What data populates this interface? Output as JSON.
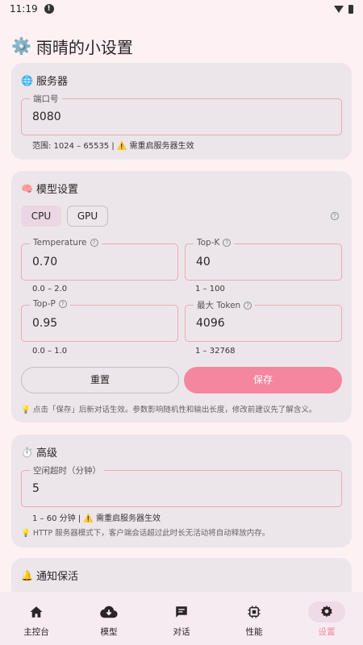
{
  "status_bar": {
    "time": "11:19"
  },
  "header": {
    "title": "雨晴的小设置"
  },
  "server": {
    "title": "服务器",
    "port_label": "端口号",
    "port_value": "8080",
    "hint": "范围: 1024 – 65535 | ⚠️ 需重启服务器生效"
  },
  "model": {
    "title": "模型设置",
    "segments": [
      "CPU",
      "GPU"
    ],
    "selected": "CPU",
    "temperature": {
      "label": "Temperature",
      "value": "0.70",
      "hint": "0.0 – 2.0"
    },
    "top_k": {
      "label": "Top-K",
      "value": "40",
      "hint": "1 – 100"
    },
    "top_p": {
      "label": "Top-P",
      "value": "0.95",
      "hint": "0.0 – 1.0"
    },
    "max_token": {
      "label": "最大 Token",
      "value": "4096",
      "hint": "1 – 32768"
    },
    "reset_label": "重置",
    "save_label": "保存",
    "note": "点击「保存」后新对话生效。参数影响随机性和输出长度，修改前建议先了解含义。"
  },
  "advanced": {
    "title": "高级",
    "timeout_label": "空闲超时（分钟）",
    "timeout_value": "5",
    "hint": "1 – 60 分钟 | ⚠️ 需重启服务器生效",
    "note": "HTTP 服务器模式下，客户端会话超过此时长无活动将自动释放内存。"
  },
  "notify": {
    "title": "通知保活"
  },
  "nav": {
    "items": [
      {
        "label": "主控台",
        "icon": "home-icon"
      },
      {
        "label": "模型",
        "icon": "cloud-download-icon"
      },
      {
        "label": "对话",
        "icon": "chat-icon"
      },
      {
        "label": "性能",
        "icon": "chip-icon"
      },
      {
        "label": "设置",
        "icon": "gear-icon"
      }
    ],
    "active": "设置"
  },
  "colors": {
    "accent": "#f4869f",
    "card": "#ece6ea",
    "background": "#fdf1f4",
    "field_border": "#e9aab8"
  }
}
